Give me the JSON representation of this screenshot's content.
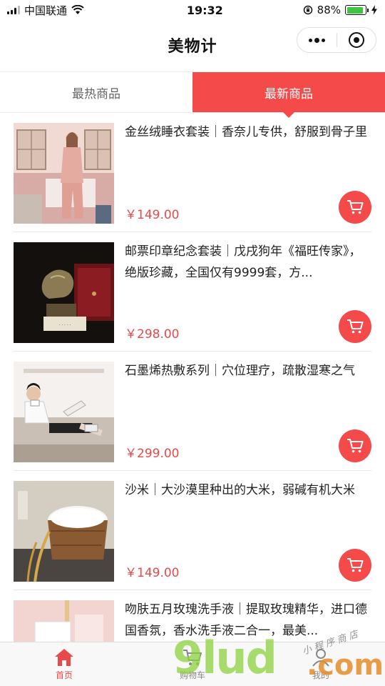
{
  "status": {
    "carrier": "中国联通",
    "time": "19:32",
    "battery": "88%",
    "battery_level": 0.88
  },
  "nav": {
    "title": "美物计"
  },
  "tabs": [
    {
      "label": "最热商品",
      "active": false
    },
    {
      "label": "最新商品",
      "active": true
    }
  ],
  "products": [
    {
      "title": "金丝绒睡衣套装｜香奈儿专供，舒服到骨子里",
      "price": "￥149.00"
    },
    {
      "title": "邮票印章纪念套装｜戊戌狗年《福旺传家》，绝版珍藏，全国仅有9999套，方...",
      "price": "￥298.00"
    },
    {
      "title": "石墨烯热敷系列｜穴位理疗，疏散湿寒之气",
      "price": "￥299.00"
    },
    {
      "title": "沙米｜大沙漠里种出的大米，弱碱有机大米",
      "price": "￥149.00"
    },
    {
      "title": "吻肤五月玫瑰洗手液｜提取玫瑰精华，进口德国香氛，香水洗手液二合一，最美...",
      "price": ""
    }
  ],
  "tabbar": [
    {
      "label": "首页",
      "icon": "home-icon",
      "active": true
    },
    {
      "label": "购物车",
      "icon": "cart-icon",
      "active": false
    },
    {
      "label": "我的",
      "icon": "user-icon",
      "active": false
    }
  ],
  "watermark": {
    "main": "9lud",
    "suffix": ".com",
    "tagline": "小程序商店"
  },
  "colors": {
    "accent": "#f44a4a",
    "price": "#e84a4a"
  }
}
